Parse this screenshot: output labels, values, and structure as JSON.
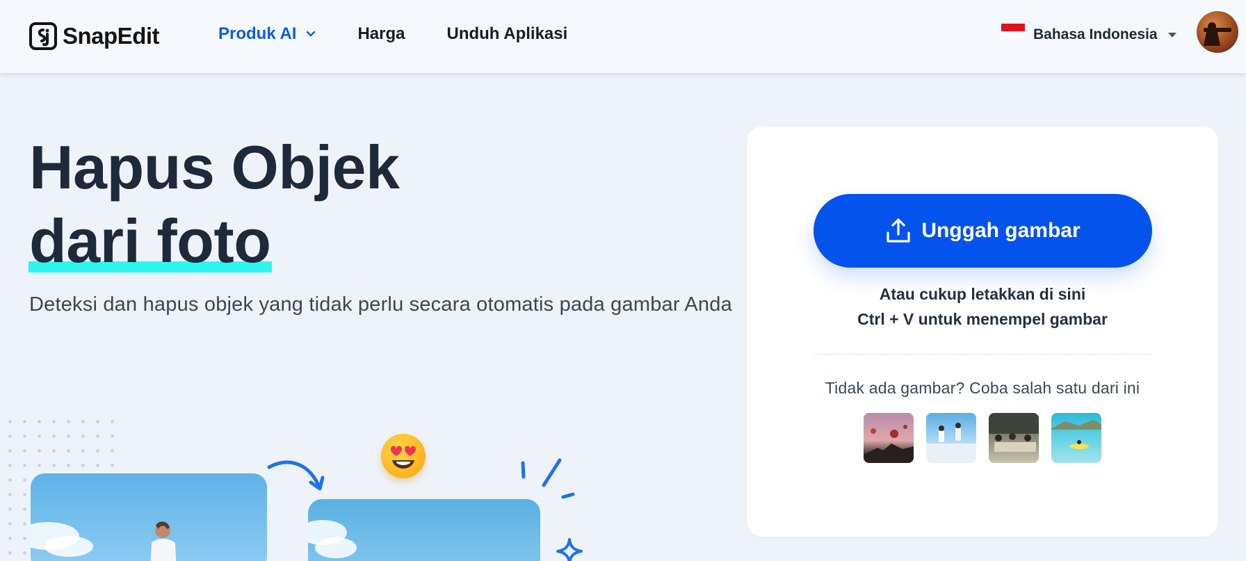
{
  "header": {
    "logo_text": "SnapEdit",
    "nav": [
      {
        "label": "Produk AI",
        "active": true,
        "has_dropdown": true
      },
      {
        "label": "Harga"
      },
      {
        "label": "Unduh Aplikasi"
      }
    ],
    "language": {
      "label": "Bahasa Indonesia",
      "flag": "indonesia-flag-icon"
    },
    "avatar": "user-avatar"
  },
  "hero": {
    "title_line1": "Hapus Objek",
    "title_line2": "dari foto",
    "subtitle": "Deteksi dan hapus objek yang tidak perlu secara otomatis pada gambar Anda"
  },
  "upload": {
    "button_label": "Unggah gambar",
    "drop_hint": "Atau cukup letakkan di sini",
    "paste_hint": "Ctrl + V untuk menempel gambar",
    "try_text": "Tidak ada gambar? Coba salah satu dari ini"
  },
  "colors": {
    "accent": "#0553ed",
    "nav_active": "#0f5ae0",
    "highlight": "#2cf6f0",
    "heading": "#1e2a3a",
    "page_bg": "#eef3f9"
  }
}
